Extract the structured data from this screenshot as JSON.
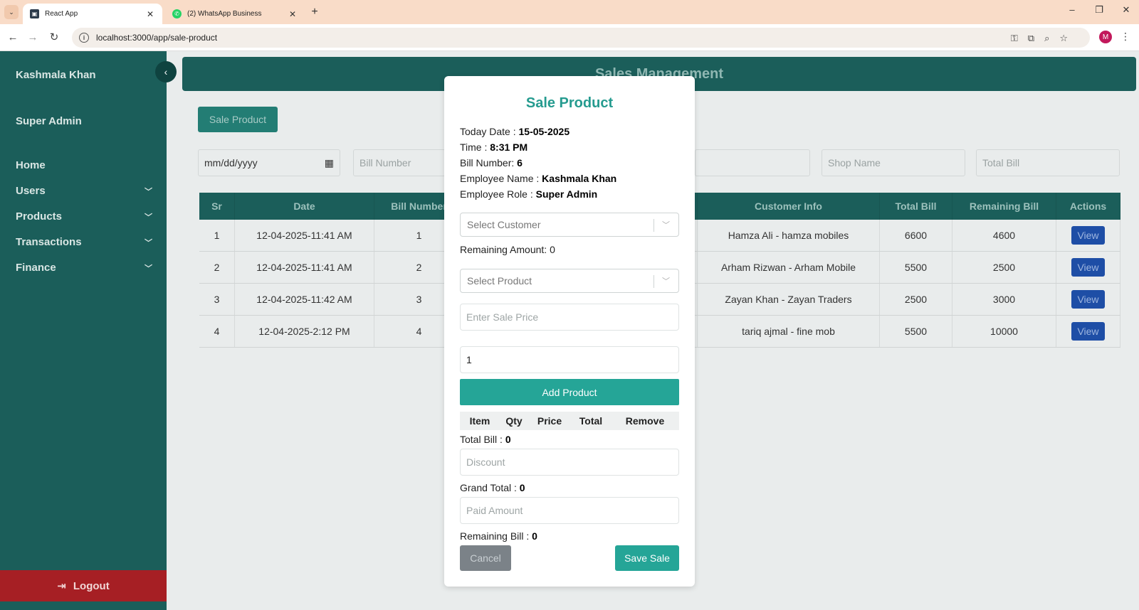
{
  "browser": {
    "tabs": [
      {
        "title": "React App",
        "active": true
      },
      {
        "title": "(2) WhatsApp Business",
        "active": false
      }
    ],
    "url": "localhost:3000/app/sale-product",
    "profile_initial": "M"
  },
  "sidebar": {
    "user_name": "Kashmala Khan",
    "role": "Super Admin",
    "items": [
      {
        "label": "Home"
      },
      {
        "label": "Users"
      },
      {
        "label": "Products"
      },
      {
        "label": "Transactions"
      },
      {
        "label": "Finance"
      }
    ],
    "logout_label": "Logout"
  },
  "main": {
    "header_title": "Sales Management",
    "sale_button_label": "Sale Product",
    "filters": {
      "date_placeholder": "mm/dd/yyyy",
      "bill_number_placeholder": "Bill Number",
      "shop_name_placeholder": "Shop Name",
      "total_bill_placeholder": "Total Bill"
    },
    "table": {
      "headers": [
        "Sr",
        "Date",
        "Bill Number",
        "Customer Info",
        "Total Bill",
        "Remaining Bill",
        "Actions"
      ],
      "rows": [
        {
          "sr": "1",
          "date": "12-04-2025-11:41 AM",
          "bill": "1",
          "customer": "Hamza Ali - hamza mobiles",
          "total": "6600",
          "remaining": "4600",
          "action": "View"
        },
        {
          "sr": "2",
          "date": "12-04-2025-11:41 AM",
          "bill": "2",
          "customer": "Arham Rizwan - Arham Mobile",
          "total": "5500",
          "remaining": "2500",
          "action": "View"
        },
        {
          "sr": "3",
          "date": "12-04-2025-11:42 AM",
          "bill": "3",
          "customer": "Zayan Khan - Zayan Traders",
          "total": "2500",
          "remaining": "3000",
          "action": "View"
        },
        {
          "sr": "4",
          "date": "12-04-2025-2:12 PM",
          "bill": "4",
          "customer": "tariq ajmal - fine mob",
          "total": "5500",
          "remaining": "10000",
          "action": "View"
        }
      ]
    }
  },
  "modal": {
    "title": "Sale Product",
    "today_date_label": "Today Date :",
    "today_date": "15-05-2025",
    "time_label": "Time :",
    "time": "8:31 PM",
    "bill_number_label": "Bill Number:",
    "bill_number": "6",
    "employee_name_label": "Employee Name :",
    "employee_name": "Kashmala Khan",
    "employee_role_label": "Employee Role :",
    "employee_role": "Super Admin",
    "customer_placeholder": "Select Customer",
    "remaining_amount_text": "Remaining Amount: 0",
    "product_placeholder": "Select Product",
    "sale_price_placeholder": "Enter Sale Price",
    "quantity_value": "1",
    "add_product_label": "Add Product",
    "items_headers": [
      "Item",
      "Qty",
      "Price",
      "Total",
      "Remove"
    ],
    "total_bill_label": "Total Bill :",
    "total_bill": "0",
    "discount_placeholder": "Discount",
    "grand_total_label": "Grand Total :",
    "grand_total": "0",
    "paid_amount_placeholder": "Paid Amount",
    "remaining_bill_label": "Remaining Bill :",
    "remaining_bill": "0",
    "cancel_label": "Cancel",
    "save_label": "Save Sale"
  }
}
